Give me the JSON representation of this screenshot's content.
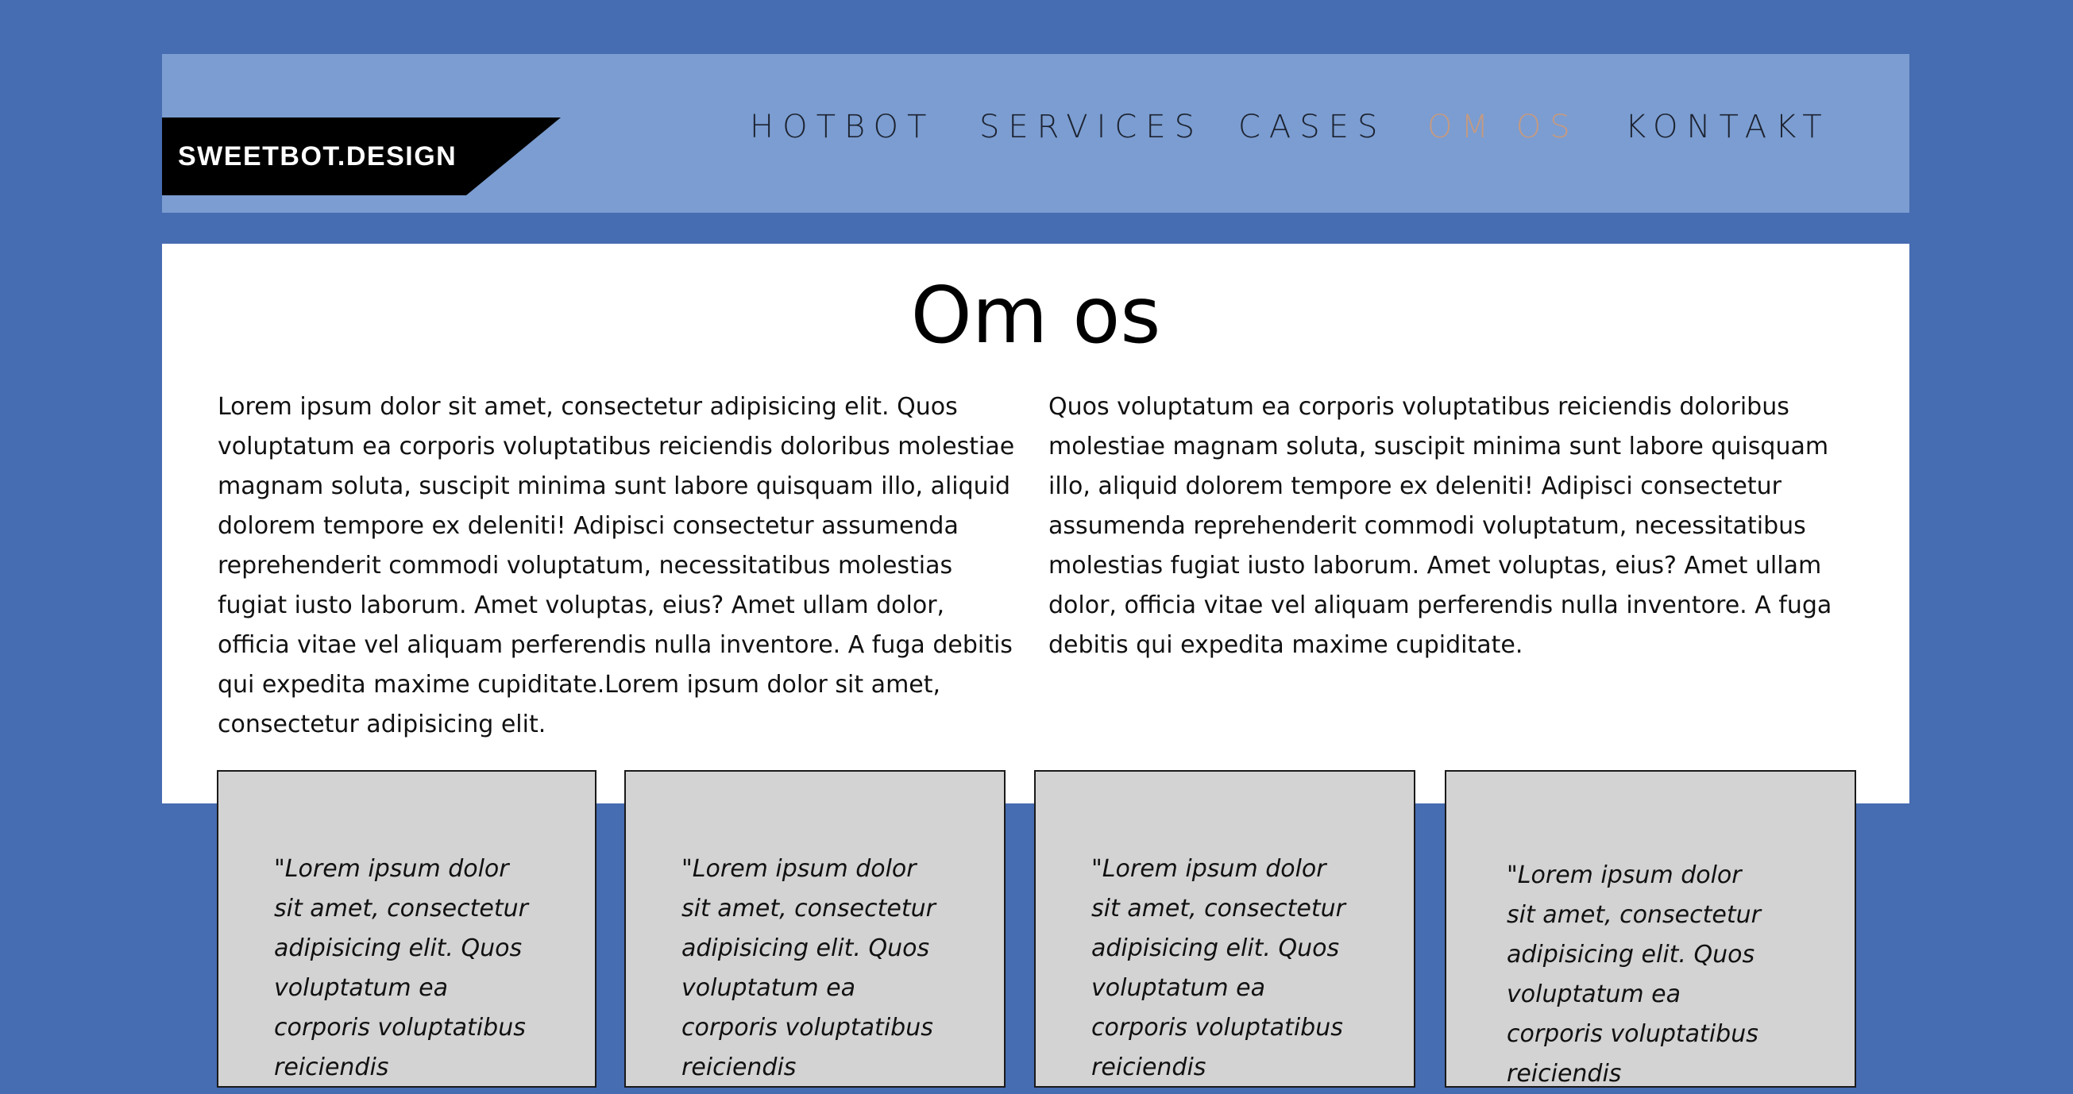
{
  "header": {
    "logo_text": "SWEETBOT.DESIGN",
    "nav": [
      {
        "label": "HOTBOT"
      },
      {
        "label": "SERVICES"
      },
      {
        "label": "CASES"
      },
      {
        "label": "OM OS",
        "active": true
      },
      {
        "label": "KONTAKT"
      }
    ]
  },
  "main": {
    "title": "Om os",
    "paragraphs": [
      "Lorem ipsum dolor sit amet, consectetur adipisicing elit. Quos voluptatum ea corporis voluptatibus reiciendis doloribus molestiae magnam soluta, suscipit minima sunt labore quisquam illo, aliquid dolorem tempore ex deleniti! Adipisci consectetur assumenda reprehenderit commodi voluptatum, necessitatibus molestias fugiat iusto laborum. Amet voluptas, eius? Amet ullam dolor, officia vitae vel aliquam perferendis nulla inventore. A fuga debitis qui expedita maxime cupiditate.Lorem ipsum dolor sit amet, consectetur adipisicing elit.",
      "Quos voluptatum ea corporis voluptatibus reiciendis doloribus molestiae magnam soluta, suscipit minima sunt labore quisquam illo, aliquid dolorem tempore ex deleniti! Adipisci consectetur assumenda reprehenderit commodi voluptatum, necessitatibus molestias fugiat iusto laborum. Amet voluptas, eius? Amet ullam dolor, officia vitae vel aliquam perferendis nulla inventore. A fuga debitis qui expedita maxime cupiditate."
    ]
  },
  "cards": [
    {
      "quote": "\"Lorem ipsum dolor sit amet, consectetur adipisicing elit. Quos voluptatum ea corporis voluptatibus reiciendis"
    },
    {
      "quote": "\"Lorem ipsum dolor sit amet, consectetur adipisicing elit. Quos voluptatum ea corporis voluptatibus reiciendis"
    },
    {
      "quote": "\"Lorem ipsum dolor sit amet, consectetur adipisicing elit. Quos voluptatum ea corporis voluptatibus reiciendis"
    },
    {
      "quote": "\"Lorem ipsum dolor sit amet, consectetur adipisicing elit. Quos voluptatum ea corporis voluptatibus reiciendis"
    }
  ],
  "colors": {
    "page_background": "#466cb1",
    "header_background": "#7b9dd1",
    "nav_text": "#1c2230",
    "nav_active": "#c49a83",
    "card_background": "#d3d3d3",
    "logo_background": "#000000"
  }
}
